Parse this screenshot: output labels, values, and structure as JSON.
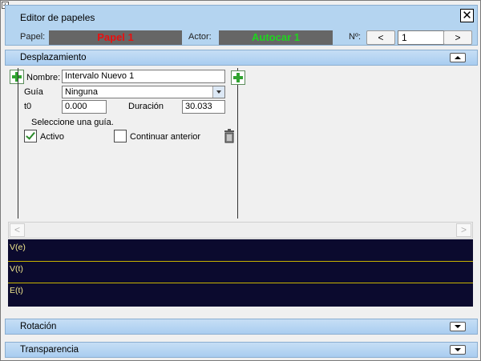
{
  "window": {
    "title": "Editor de papeles",
    "close_glyph": "✕"
  },
  "header": {
    "paper_label": "Papel:",
    "paper_value": "Papel 1",
    "paper_color": "#e81010",
    "actor_label": "Actor:",
    "actor_value": "Autocar 1",
    "actor_color": "#1fd41f",
    "number_label": "Nº:",
    "prev_label": "<",
    "next_label": ">",
    "number_value": "1"
  },
  "sections": {
    "displacement": "Desplazamiento",
    "rotation": "Rotación",
    "transparency": "Transparencia"
  },
  "form": {
    "name_label": "Nombre:",
    "name_value": "Intervalo Nuevo 1",
    "guide_label": "Guía",
    "guide_value": "Ninguna",
    "t0_label": "t0",
    "t0_value": "0.000",
    "duration_label": "Duración",
    "duration_value": "30.033",
    "hint": "Seleccione una guía.",
    "active_label": "Activo",
    "active_checked": true,
    "continue_label": "Continuar anterior",
    "continue_checked": false
  },
  "scrollbar": {
    "left": "<",
    "right": ">"
  },
  "graph": {
    "labels": [
      "V(e)",
      "V(t)",
      "E(t)"
    ],
    "background": "#0b0a2e",
    "line_color": "#c8b400"
  }
}
